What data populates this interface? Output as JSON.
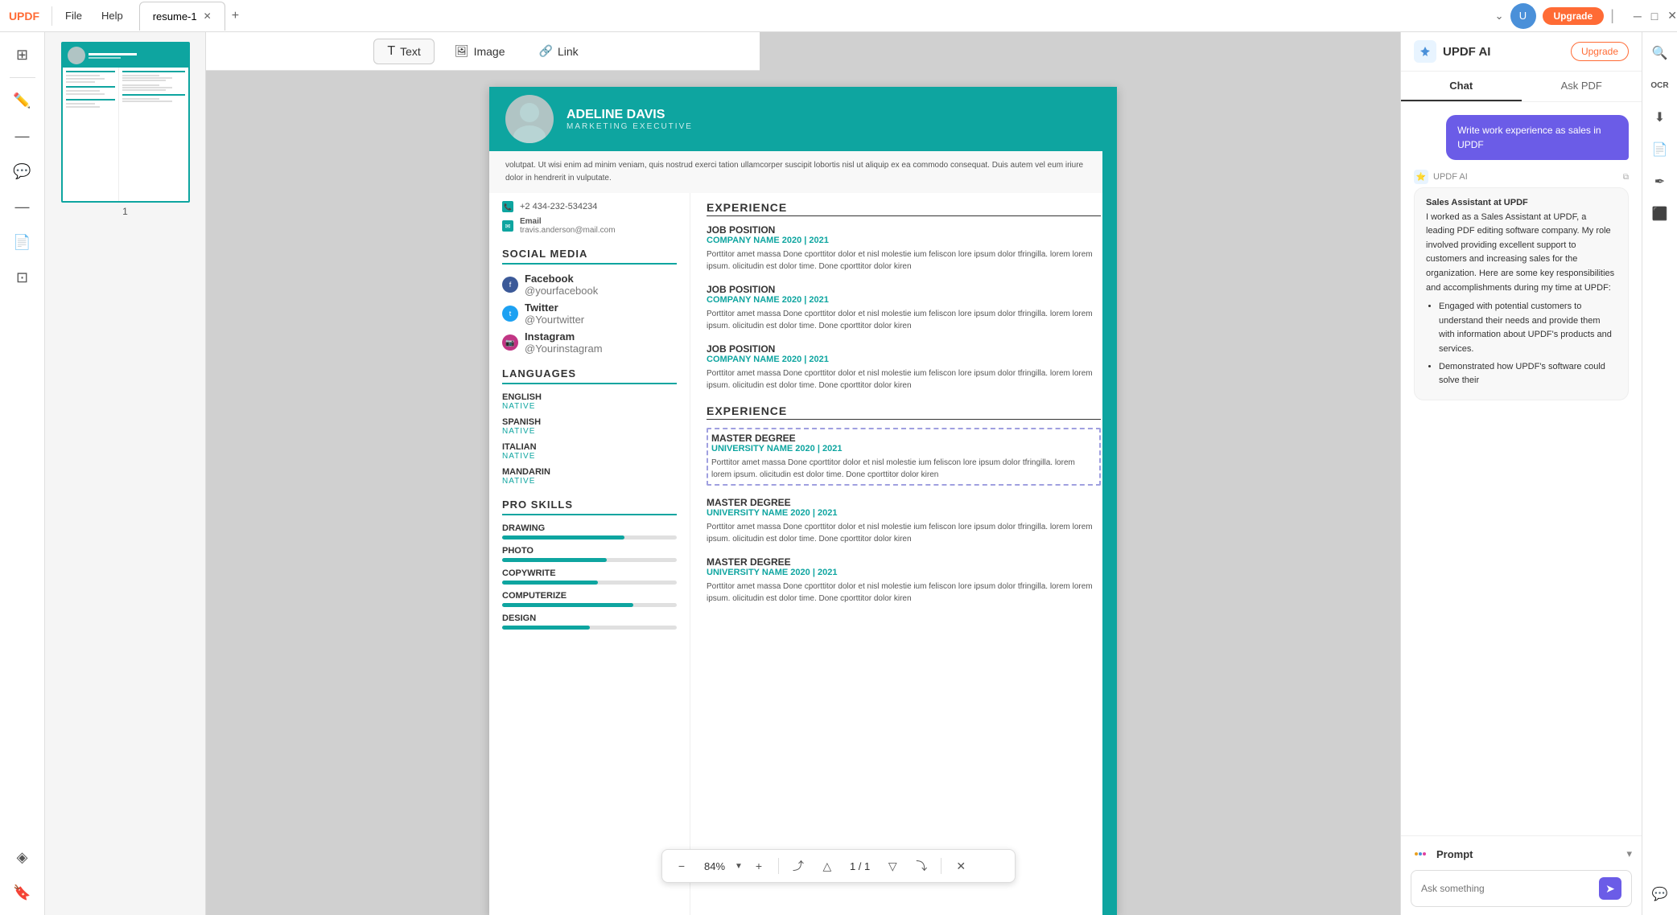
{
  "titlebar": {
    "logo": "UPDF",
    "menu": [
      "File",
      "Help"
    ],
    "tab": "resume-1",
    "upgrade_label": "Upgrade"
  },
  "toolbar": {
    "text_label": "Text",
    "image_label": "Image",
    "link_label": "Link"
  },
  "resume": {
    "name": "ADELINE DAVIS",
    "role": "MARKETING EXECUTIVE",
    "phone": "+2 434-232-534234",
    "email_label": "Email",
    "email": "travis.anderson@mail.com",
    "intro": "volutpat. Ut wisi enim ad minim veniam, quis nostrud exerci tation ullamcorper suscipit lobortis nisl ut aliquip ex ea commodo consequat. Duis autem vel eum iriure dolor in hendrerit in vulputate.",
    "social_media_title": "SOCIAL MEDIA",
    "socials": [
      {
        "platform": "Facebook",
        "handle": "@yourfacebook"
      },
      {
        "platform": "Twitter",
        "handle": "@Yourtwitter"
      },
      {
        "platform": "Instagram",
        "handle": "@Yourinstagram"
      }
    ],
    "languages_title": "LANGUAGES",
    "languages": [
      {
        "name": "ENGLISH",
        "level": "NATIVE"
      },
      {
        "name": "SPANISH",
        "level": "NATIVE"
      },
      {
        "name": "ITALIAN",
        "level": "NATIVE"
      },
      {
        "name": "MANDARIN",
        "level": "NATIVE"
      }
    ],
    "pro_skills_title": "PRO SKILLS",
    "skills": [
      {
        "name": "DRAWING",
        "pct": 70
      },
      {
        "name": "PHOTO",
        "pct": 60
      },
      {
        "name": "COPYWRITE",
        "pct": 55
      },
      {
        "name": "COMPUTERIZE",
        "pct": 75
      },
      {
        "name": "DESIGN",
        "pct": 50
      }
    ],
    "experience_title": "EXPERIENCE",
    "jobs": [
      {
        "title": "JOB POSITION",
        "company": "COMPANY NAME 2020 | 2021",
        "desc": "Porttitor amet massa Done cporttitor dolor et nisl molestie ium feliscon lore ipsum dolor tfringilla. lorem lorem ipsum. olicitudin est dolor time. Done cporttitor dolor kiren"
      },
      {
        "title": "JOB POSITION",
        "company": "COMPANY NAME 2020 | 2021",
        "desc": "Porttitor amet massa Done cporttitor dolor et nisl molestie ium feliscon lore ipsum dolor tfringilla. lorem lorem ipsum. olicitudin est dolor time. Done cporttitor dolor kiren"
      },
      {
        "title": "JOB POSITION",
        "company": "COMPANY NAME 2020 | 2021",
        "desc": "Porttitor amet massa Done cporttitor dolor et nisl molestie ium feliscon lore ipsum dolor tfringilla. lorem lorem ipsum. olicitudin est dolor time. Done cporttitor dolor kiren"
      }
    ],
    "education_title": "EXPERIENCE",
    "education": [
      {
        "degree": "MASTER DEGREE",
        "school": "UNIVERSITY NAME 2020 | 2021",
        "desc": "Porttitor amet massa Done cporttitor dolor et nisl molestie ium feliscon lore ipsum dolor tfringilla. lorem lorem ipsum. olicitudin est dolor time. Done cporttitor dolor kiren",
        "selected": true
      },
      {
        "degree": "MASTER DEGREE",
        "school": "UNIVERSITY NAME 2020 | 2021",
        "desc": "Porttitor amet massa Done cporttitor dolor et nisl molestie ium feliscon lore ipsum dolor tfringilla. lorem lorem ipsum. olicitudin est dolor time. Done cporttitor dolor kiren",
        "selected": false
      },
      {
        "degree": "MASTER DEGREE",
        "school": "UNIVERSITY NAME 2020 | 2021",
        "desc": "Porttitor amet massa Done cporttitor dolor et nisl molestie ium feliscon lore ipsum dolor tfringilla. lorem lorem ipsum. olicitudin est dolor time. Done cporttitor dolor kiren",
        "selected": false
      }
    ]
  },
  "zoom": {
    "level": "84%",
    "current_page": "1",
    "total_pages": "1"
  },
  "ai": {
    "title": "UPDF AI",
    "upgrade_label": "Upgrade",
    "tab_chat": "Chat",
    "tab_ask_pdf": "Ask PDF",
    "user_msg": "Write work experience as sales in UPDF",
    "bot_label": "UPDF AI",
    "bot_response_intro": "Sales Assistant at UPDF\nI worked as a Sales Assistant at UPDF, a leading PDF editing software company. My role involved providing excellent support to customers and increasing sales for the organization. Here are some key responsibilities and accomplishments during my time at UPDF:",
    "bot_bullets": [
      "Engaged with potential customers to understand their needs and provide them with information about UPDF's products and services.",
      "Demonstrated how UPDF's software could solve their"
    ],
    "prompt_label": "Prompt",
    "input_placeholder": "Ask something"
  },
  "thumbnail": {
    "page_num": "1"
  }
}
